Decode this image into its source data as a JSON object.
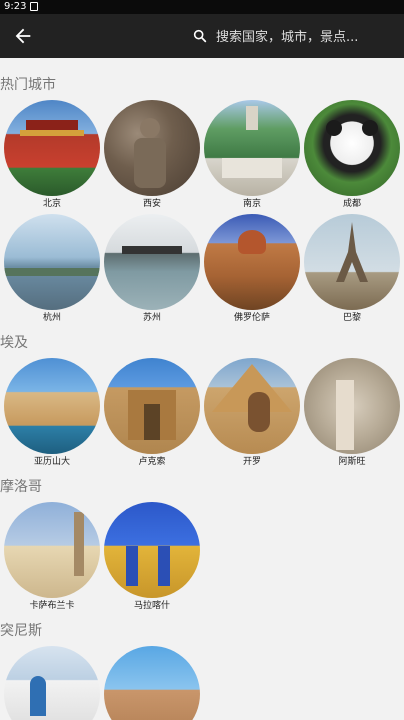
{
  "statusbar": {
    "time": "9:23"
  },
  "search": {
    "placeholder": "搜索国家，城市，景点..."
  },
  "sections": [
    {
      "title": "热门城市",
      "cities": [
        "北京",
        "西安",
        "南京",
        "成都",
        "杭州",
        "苏州",
        "佛罗伦萨",
        "巴黎"
      ]
    },
    {
      "title": "埃及",
      "cities": [
        "亚历山大",
        "卢克索",
        "开罗",
        "阿斯旺"
      ]
    },
    {
      "title": "摩洛哥",
      "cities": [
        "卡萨布兰卡",
        "马拉喀什"
      ]
    },
    {
      "title": "突尼斯",
      "cities": [
        "",
        ""
      ]
    }
  ],
  "colors": {
    "appbar": "#222222",
    "background": "#f2f2f2",
    "section_title": "#777777"
  }
}
